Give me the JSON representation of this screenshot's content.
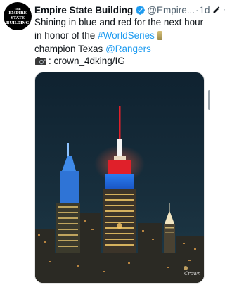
{
  "account": {
    "avatar_lines": [
      "THE",
      "EMPIRE",
      "STATE",
      "BUILDING"
    ],
    "name": "Empire State Building",
    "handle": "@Empire...",
    "separator": "·",
    "time": "1d",
    "verified_color": "#1d9bf0"
  },
  "tweet": {
    "text_1": "Shining in blue and red for the next hour in honor of the ",
    "hashtag": "#WorldSeries",
    "text_2": " champion Texas",
    "mention": "@Rangers",
    "credit_text": ": crown_4dking/IG",
    "camera_icon": "camera-icon",
    "trophy_icon": "trophy-icon"
  },
  "photo": {
    "watermark": "Crown",
    "colors": {
      "sky_top": "#0f2230",
      "sky_bottom": "#1b3443",
      "tower_red": "#e0202a",
      "tower_blue": "#1f6fe0",
      "spire_white": "#f4f4f4"
    }
  },
  "colors": {
    "link": "#1d9bf0",
    "muted": "#536471",
    "text": "#0f1419"
  }
}
